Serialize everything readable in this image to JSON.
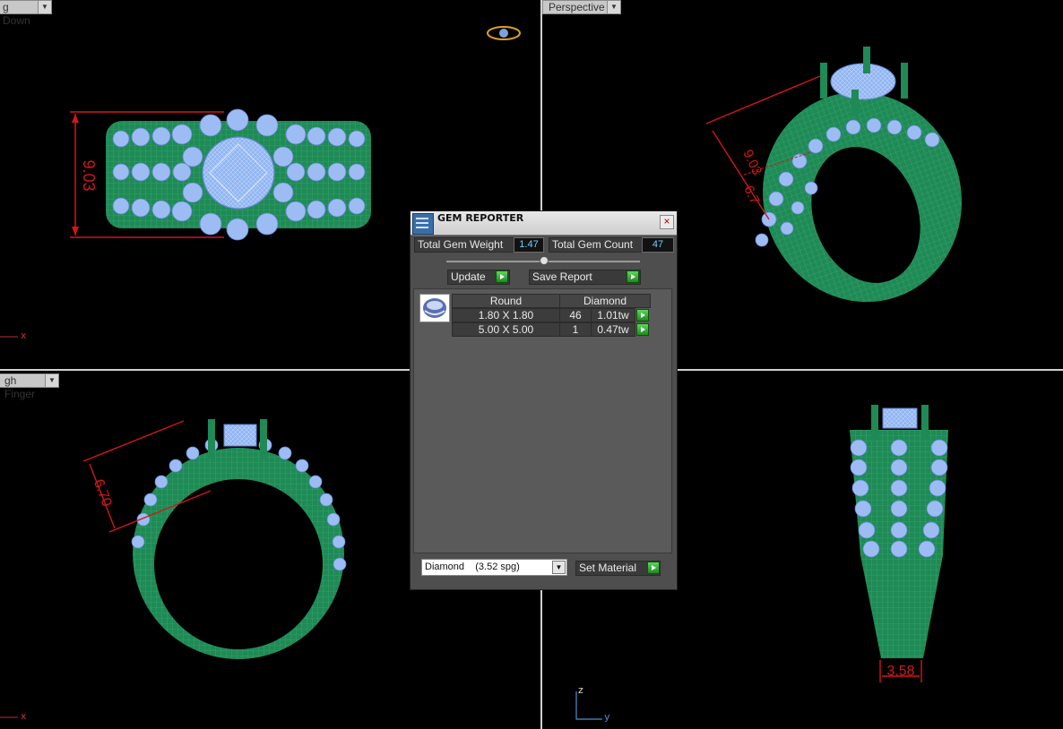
{
  "viewports": {
    "top_left": {
      "label": "Down",
      "label_prefix": "g"
    },
    "top_right": {
      "label": "Perspective"
    },
    "bottom_left": {
      "label": "gh Finger"
    }
  },
  "dimensions": {
    "top_left": "9.03",
    "top_right_1": "9.03",
    "top_right_2": "6.7",
    "bottom_left": "6.70",
    "bottom_right": "3.58"
  },
  "axes": {
    "x1": "x",
    "x2": "x",
    "z": "z",
    "y": "y"
  },
  "gem_reporter": {
    "title": "GEM REPORTER",
    "total_weight_label": "Total Gem Weight",
    "total_weight_value": "1.47",
    "total_count_label": "Total Gem Count",
    "total_count_value": "47",
    "update_label": "Update",
    "save_report_label": "Save Report",
    "table": {
      "headers": [
        "Round",
        "Diamond"
      ],
      "rows": [
        {
          "size": "1.80 X 1.80",
          "count": "46",
          "weight": "1.01tw"
        },
        {
          "size": "5.00 X 5.00",
          "count": "1",
          "weight": "0.47tw"
        }
      ]
    },
    "material_selected": "Diamond    (3.52 spg)",
    "set_material_label": "Set Material"
  },
  "colors": {
    "metal": "#1f8a55",
    "gem": "#8fb4f0",
    "dimension": "#d01818",
    "value_text": "#6fd0ff"
  }
}
